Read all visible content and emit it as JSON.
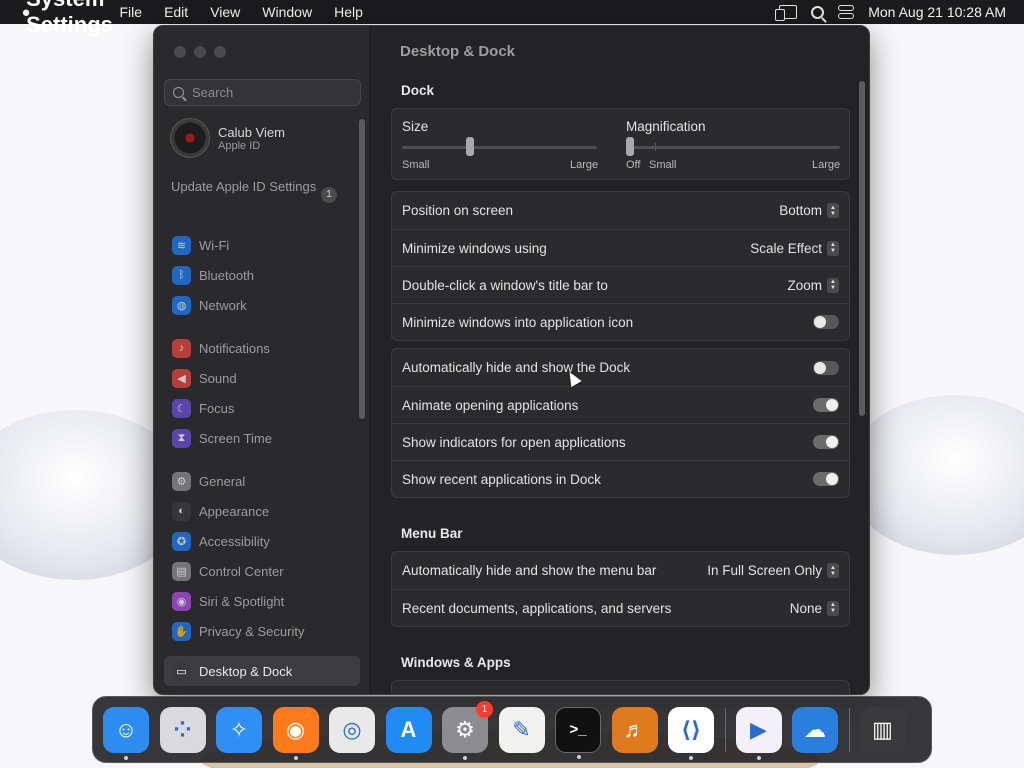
{
  "menubar": {
    "app_name": "System Settings",
    "menus": [
      "File",
      "Edit",
      "View",
      "Window",
      "Help"
    ],
    "datetime": "Mon Aug 21  10:28 AM"
  },
  "sidebar": {
    "search_placeholder": "Search",
    "account_name": "Calub Viem",
    "account_sub": "Apple ID",
    "update_text": "Update Apple ID Settings",
    "update_badge": "1",
    "groups": [
      [
        {
          "label": "Wi-Fi",
          "icon": "wifi-icon",
          "color": "#1a7cf5"
        },
        {
          "label": "Bluetooth",
          "icon": "bluetooth-icon",
          "color": "#1a7cf5"
        },
        {
          "label": "Network",
          "icon": "globe-icon",
          "color": "#1a7cf5"
        }
      ],
      [
        {
          "label": "Notifications",
          "icon": "bell-icon",
          "color": "#e8453c"
        },
        {
          "label": "Sound",
          "icon": "speaker-icon",
          "color": "#e8453c"
        },
        {
          "label": "Focus",
          "icon": "moon-icon",
          "color": "#6a4fd8"
        },
        {
          "label": "Screen Time",
          "icon": "hourglass-icon",
          "color": "#6a4fd8"
        }
      ],
      [
        {
          "label": "General",
          "icon": "gear-icon",
          "color": "#8e8e93"
        },
        {
          "label": "Appearance",
          "icon": "appearance-icon",
          "color": "#3a3a3c"
        },
        {
          "label": "Accessibility",
          "icon": "accessibility-icon",
          "color": "#1a7cf5"
        },
        {
          "label": "Control Center",
          "icon": "control-center-icon",
          "color": "#8e8e93"
        },
        {
          "label": "Siri & Spotlight",
          "icon": "siri-icon",
          "color": "#b04fe0"
        },
        {
          "label": "Privacy & Security",
          "icon": "hand-icon",
          "color": "#1a7cf5"
        }
      ],
      [
        {
          "label": "Desktop & Dock",
          "icon": "desktop-dock-icon",
          "color": "#3a3a3c",
          "active": true
        }
      ]
    ]
  },
  "content": {
    "page_title": "Desktop & Dock",
    "dock_section": "Dock",
    "size_label": "Size",
    "size_min": "Small",
    "size_max": "Large",
    "size_value": 0.35,
    "mag_label": "Magnification",
    "mag_off": "Off",
    "mag_min": "Small",
    "mag_max": "Large",
    "mag_value": 0.0,
    "group1": [
      {
        "label": "Position on screen",
        "value": "Bottom",
        "kind": "popup"
      },
      {
        "label": "Minimize windows using",
        "value": "Scale Effect",
        "kind": "popup"
      },
      {
        "label": "Double-click a window's title bar to",
        "value": "Zoom",
        "kind": "popup"
      },
      {
        "label": "Minimize windows into application icon",
        "kind": "toggle",
        "on": false
      }
    ],
    "group2": [
      {
        "label": "Automatically hide and show the Dock",
        "kind": "toggle",
        "on": false
      },
      {
        "label": "Animate opening applications",
        "kind": "toggle",
        "on": true
      },
      {
        "label": "Show indicators for open applications",
        "kind": "toggle",
        "on": true
      },
      {
        "label": "Show recent applications in Dock",
        "kind": "toggle",
        "on": true
      }
    ],
    "menubar_section": "Menu Bar",
    "group3": [
      {
        "label": "Automatically hide and show the menu bar",
        "value": "In Full Screen Only",
        "kind": "popup"
      },
      {
        "label": "Recent documents, applications, and servers",
        "value": "None",
        "kind": "popup"
      }
    ],
    "windows_section": "Windows & Apps"
  },
  "dock": {
    "apps": [
      {
        "name": "finder",
        "icon": "finder-icon",
        "color": "#2d8cf0",
        "running": true
      },
      {
        "name": "launchpad",
        "icon": "launchpad-icon",
        "color": "#d9d9de",
        "running": false
      },
      {
        "name": "safari",
        "icon": "safari-icon",
        "color": "#2f8ff5",
        "running": false
      },
      {
        "name": "firefox",
        "icon": "firefox-icon",
        "color": "#ff7a1a",
        "running": true
      },
      {
        "name": "chrome",
        "icon": "chrome-icon",
        "color": "#e9e9ea",
        "running": false
      },
      {
        "name": "app-store",
        "icon": "app-store-icon",
        "color": "#1f8bf3",
        "running": false
      },
      {
        "name": "system-settings",
        "icon": "gear-icon",
        "color": "#8c8c90",
        "running": true,
        "badge": "1"
      },
      {
        "name": "textedit",
        "icon": "textedit-icon",
        "color": "#f1f1ef",
        "running": false
      },
      {
        "name": "terminal",
        "icon": "terminal-icon",
        "color": "#111112",
        "running": true
      },
      {
        "name": "garageband",
        "icon": "guitar-icon",
        "color": "#e07a1f",
        "running": false
      },
      {
        "name": "vscode",
        "icon": "vscode-icon",
        "color": "#ffffff",
        "running": true
      }
    ],
    "recent": [
      {
        "name": "visual-studio",
        "icon": "visual-studio-icon",
        "color": "#f4f0fa",
        "running": true
      },
      {
        "name": "weather",
        "icon": "weather-icon",
        "color": "#2a7fdc",
        "running": false
      }
    ],
    "trash": {
      "name": "trash",
      "icon": "trash-icon",
      "color": "#3a3a3c"
    }
  }
}
